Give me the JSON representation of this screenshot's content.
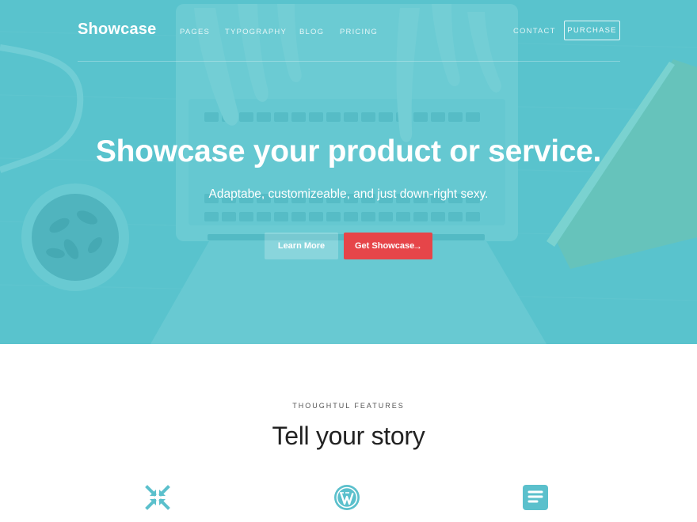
{
  "nav": {
    "brand": "Showcase",
    "links": [
      "PAGES",
      "TYPOGRAPHY",
      "BLOG",
      "PRICING"
    ],
    "contact": "CONTACT",
    "purchase": "PURCHASE"
  },
  "hero": {
    "headline": "Showcase your product or service.",
    "subheadline": "Adaptabe, customizeable, and just down-right sexy.",
    "learn_more": "Learn More",
    "get_showcase": "Get Showcase",
    "arrow": "→"
  },
  "features": {
    "eyebrow": "THOUGHTUL FEATURES",
    "title": "Tell your story",
    "icons": [
      "compress-arrows-icon",
      "wordpress-icon",
      "document-icon"
    ]
  },
  "colors": {
    "accent": "#5bc3cd",
    "cta": "#e64549",
    "icon": "#5bc0cc"
  }
}
